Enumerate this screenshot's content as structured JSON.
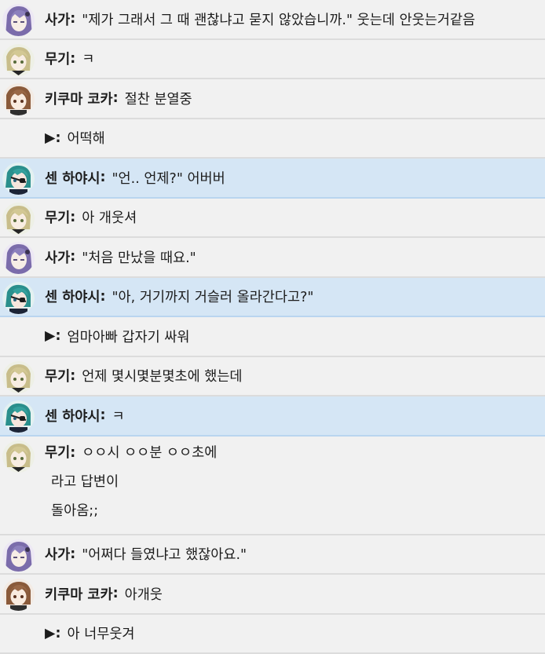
{
  "speakers": {
    "saga": {
      "name": "사가",
      "avatar": "saga-avatar"
    },
    "mugi": {
      "name": "무기",
      "avatar": "mugi-avatar"
    },
    "kokka": {
      "name": "키쿠마 코카",
      "avatar": "kokka-avatar"
    },
    "sen": {
      "name": "센 하야시",
      "avatar": "sen-avatar"
    },
    "you": {
      "name": "▶"
    }
  },
  "colors": {
    "row_bg": "#f1f1f1",
    "highlight_bg": "#d5e6f5",
    "divider": "#dcdcdc"
  },
  "messages": [
    {
      "speaker": "saga",
      "lines": [
        "\"제가 그래서 그 때 괜찮냐고 묻지 않았습니까.\" 웃는데 안웃는거같음"
      ]
    },
    {
      "speaker": "mugi",
      "lines": [
        "ㅋ"
      ]
    },
    {
      "speaker": "kokka",
      "lines": [
        "절찬 분열중"
      ]
    },
    {
      "speaker": "you",
      "lines": [
        "어떡해"
      ]
    },
    {
      "speaker": "sen",
      "lines": [
        "\"언.. 언제?\" 어버버"
      ]
    },
    {
      "speaker": "mugi",
      "lines": [
        "아 개웃셔"
      ]
    },
    {
      "speaker": "saga",
      "lines": [
        "\"처음 만났을 때요.\""
      ]
    },
    {
      "speaker": "sen",
      "lines": [
        "\"아, 거기까지 거슬러 올라간다고?\""
      ]
    },
    {
      "speaker": "you",
      "lines": [
        "엄마아빠 갑자기 싸워"
      ]
    },
    {
      "speaker": "mugi",
      "lines": [
        "언제 몇시몇분몇초에 했는데"
      ]
    },
    {
      "speaker": "sen",
      "lines": [
        "ㅋ"
      ]
    },
    {
      "speaker": "mugi",
      "lines": [
        "ㅇㅇ시 ㅇㅇ분 ㅇㅇ초에",
        "라고 답변이",
        "돌아옴;;"
      ]
    },
    {
      "speaker": "saga",
      "lines": [
        "\"어쩌다 들였냐고 했잖아요.\""
      ]
    },
    {
      "speaker": "kokka",
      "lines": [
        "아개웃"
      ]
    },
    {
      "speaker": "you",
      "lines": [
        "아 너무웃겨"
      ]
    }
  ]
}
